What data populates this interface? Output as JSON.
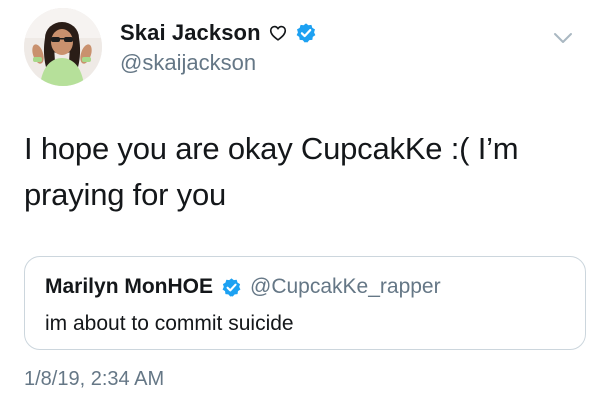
{
  "author": {
    "display_name": "Skai Jackson",
    "handle": "@skaijackson",
    "avatar_icon": "profile-photo",
    "name_suffix_icon": "heart-outline-icon",
    "verified_icon": "verified-badge-icon",
    "verified_color": "#1da1f2"
  },
  "menu": {
    "chevron_icon": "chevron-down-icon"
  },
  "tweet": {
    "text_line1": "I hope you are okay CupcakKe :( I’m",
    "text_line2": "praying for you",
    "timestamp": "1/8/19, 2:34 AM"
  },
  "quoted_tweet": {
    "display_name": "Marilyn MonHOE",
    "handle": "@CupcakKe_rapper",
    "text": "im about to commit suicide",
    "verified_icon": "verified-badge-icon"
  },
  "colors": {
    "text_primary": "#14171a",
    "text_secondary": "#657786",
    "border": "#ccd6dd",
    "verified": "#1da1f2"
  }
}
